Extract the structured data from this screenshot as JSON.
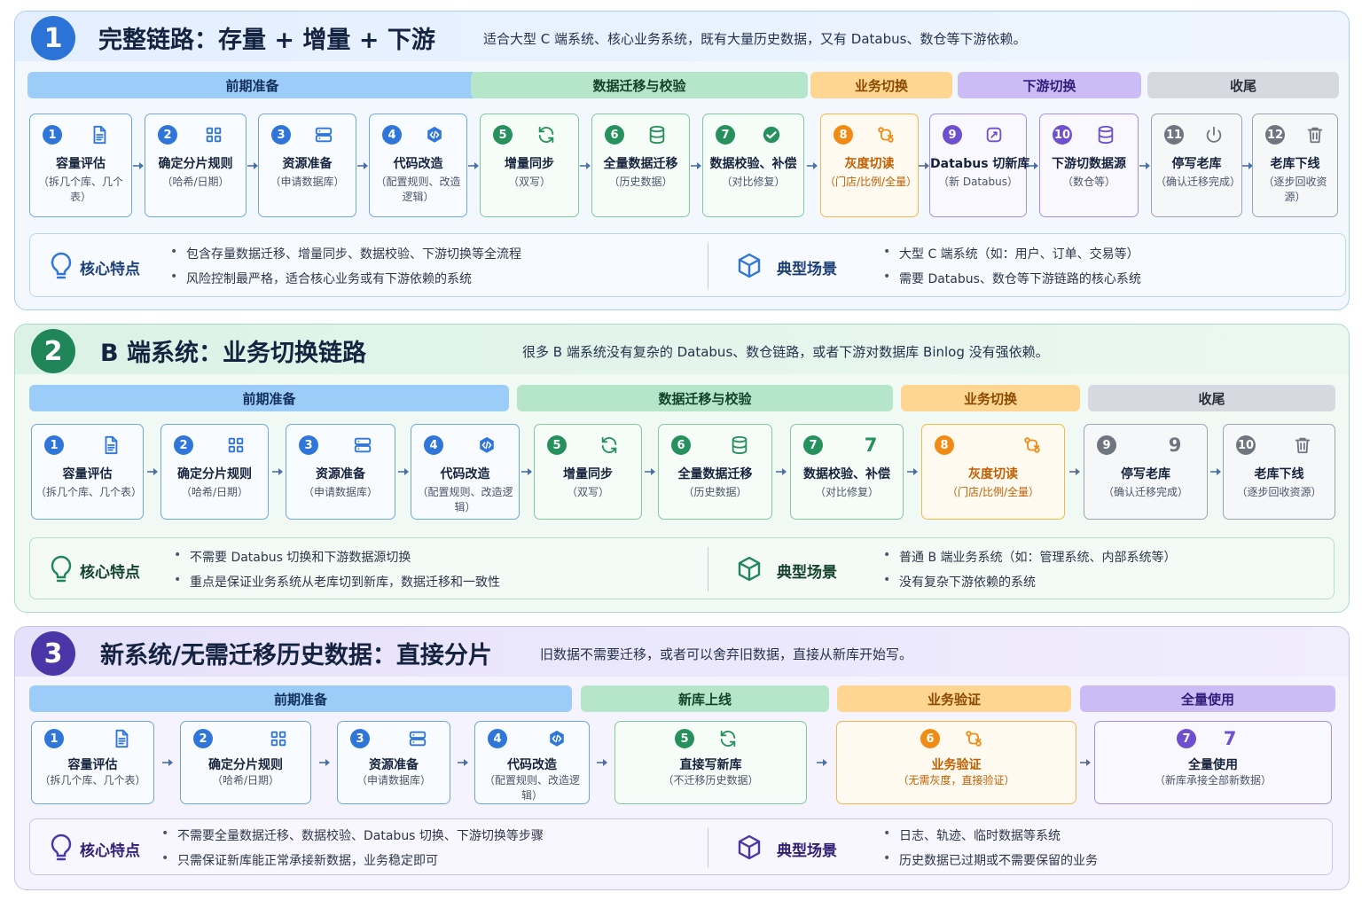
{
  "colors": {
    "blue": "#2f76d8",
    "green": "#27915d",
    "orange": "#f08c16",
    "purple": "#6e4fd0",
    "gray": "#6f7680"
  },
  "sections": [
    {
      "num": "1",
      "title": "完整链路：存量 + 增量 + 下游",
      "desc": "适合大型 C 端系统、核心业务系统，既有大量历史数据，又有 Databus、数仓等下游依赖。",
      "phases": [
        "前期准备",
        "数据迁移与校验",
        "业务切换",
        "下游切换",
        "收尾"
      ],
      "steps": [
        {
          "num": "1",
          "icon": "document-icon",
          "title": "容量评估",
          "sub": "（拆几个库、几个表）"
        },
        {
          "num": "2",
          "icon": "grid-icon",
          "title": "确定分片规则",
          "sub": "（哈希/日期）"
        },
        {
          "num": "3",
          "icon": "server-icon",
          "title": "资源准备",
          "sub": "（申请数据库）"
        },
        {
          "num": "4",
          "icon": "code-icon",
          "title": "代码改造",
          "sub": "（配置规则、改造逻辑）"
        },
        {
          "num": "5",
          "icon": "sync-icon",
          "title": "增量同步",
          "sub": "（双写）"
        },
        {
          "num": "6",
          "icon": "database-icon",
          "title": "全量数据迁移",
          "sub": "（历史数据）"
        },
        {
          "num": "7",
          "icon": "check-icon",
          "title": "数据校验、补偿",
          "sub": "（对比修复）"
        },
        {
          "num": "8",
          "icon": "switch-icon",
          "title": "灰度切读",
          "sub": "（门店/比例/全量）"
        },
        {
          "num": "9",
          "icon": "databus-icon",
          "title": "Databus 切新库",
          "sub": "（新 Databus）"
        },
        {
          "num": "10",
          "icon": "database-icon",
          "title": "下游切数据源",
          "sub": "（数仓等）"
        },
        {
          "num": "11",
          "icon": "power-icon",
          "title": "停写老库",
          "sub": "（确认迁移完成）"
        },
        {
          "num": "12",
          "icon": "trash-icon",
          "title": "老库下线",
          "sub": "（逐步回收资源）"
        }
      ],
      "feature_label": "核心特点",
      "features": [
        "包含存量数据迁移、增量同步、数据校验、下游切换等全流程",
        "风险控制最严格，适合核心业务或有下游依赖的系统"
      ],
      "scenario_label": "典型场景",
      "scenarios": [
        "大型 C 端系统（如：用户、订单、交易等）",
        "需要 Databus、数仓等下游链路的核心系统"
      ]
    },
    {
      "num": "2",
      "title": "B 端系统：业务切换链路",
      "desc": "很多 B 端系统没有复杂的 Databus、数仓链路，或者下游对数据库 Binlog 没有强依赖。",
      "phases": [
        "前期准备",
        "数据迁移与校验",
        "业务切换",
        "收尾"
      ],
      "steps": [
        {
          "num": "1",
          "icon": "document-icon",
          "title": "容量评估",
          "sub": "（拆几个库、几个表）"
        },
        {
          "num": "2",
          "icon": "grid-icon",
          "title": "确定分片规则",
          "sub": "（哈希/日期）"
        },
        {
          "num": "3",
          "icon": "server-icon",
          "title": "资源准备",
          "sub": "（申请数据库）"
        },
        {
          "num": "4",
          "icon": "code-icon",
          "title": "代码改造",
          "sub": "（配置规则、改造逻辑）"
        },
        {
          "num": "5",
          "icon": "sync-icon",
          "title": "增量同步",
          "sub": "（双写）"
        },
        {
          "num": "6",
          "icon": "database-icon",
          "title": "全量数据迁移",
          "sub": "（历史数据）"
        },
        {
          "num": "7",
          "icon": "7",
          "title": "数据校验、补偿",
          "sub": "（对比修复）"
        },
        {
          "num": "8",
          "icon": "switch-icon",
          "title": "灰度切读",
          "sub": "（门店/比例/全量）"
        },
        {
          "num": "9",
          "icon": "9",
          "title": "停写老库",
          "sub": "（确认迁移完成）"
        },
        {
          "num": "10",
          "icon": "trash-icon",
          "title": "老库下线",
          "sub": "（逐步回收资源）"
        }
      ],
      "feature_label": "核心特点",
      "features": [
        "不需要 Databus 切换和下游数据源切换",
        "重点是保证业务系统从老库切到新库，数据迁移和一致性"
      ],
      "scenario_label": "典型场景",
      "scenarios": [
        "普通 B 端业务系统（如：管理系统、内部系统等）",
        "没有复杂下游依赖的系统"
      ]
    },
    {
      "num": "3",
      "title": "新系统/无需迁移历史数据：直接分片",
      "desc": "旧数据不需要迁移，或者可以舍弃旧数据，直接从新库开始写。",
      "phases": [
        "前期准备",
        "新库上线",
        "业务验证",
        "全量使用"
      ],
      "steps": [
        {
          "num": "1",
          "icon": "document-icon",
          "title": "容量评估",
          "sub": "（拆几个库、几个表）"
        },
        {
          "num": "2",
          "icon": "grid-icon",
          "title": "确定分片规则",
          "sub": "（哈希/日期）"
        },
        {
          "num": "3",
          "icon": "server-icon",
          "title": "资源准备",
          "sub": "（申请数据库）"
        },
        {
          "num": "4",
          "icon": "code-icon",
          "title": "代码改造",
          "sub": "（配置规则、改造逻辑）"
        },
        {
          "num": "5",
          "icon": "sync-icon",
          "title": "直接写新库",
          "sub": "（不迁移历史数据）"
        },
        {
          "num": "6",
          "icon": "switch-icon",
          "title": "业务验证",
          "sub": "（无需灰度，直接验证）"
        },
        {
          "num": "7",
          "icon": "7",
          "title": "全量使用",
          "sub": "（新库承接全部新数据）"
        }
      ],
      "feature_label": "核心特点",
      "features": [
        "不需要全量数据迁移、数据校验、Databus 切换、下游切换等步骤",
        "只需保证新库能正常承接新数据，业务稳定即可"
      ],
      "scenario_label": "典型场景",
      "scenarios": [
        "日志、轨迹、临时数据等系统",
        "历史数据已过期或不需要保留的业务"
      ]
    }
  ]
}
